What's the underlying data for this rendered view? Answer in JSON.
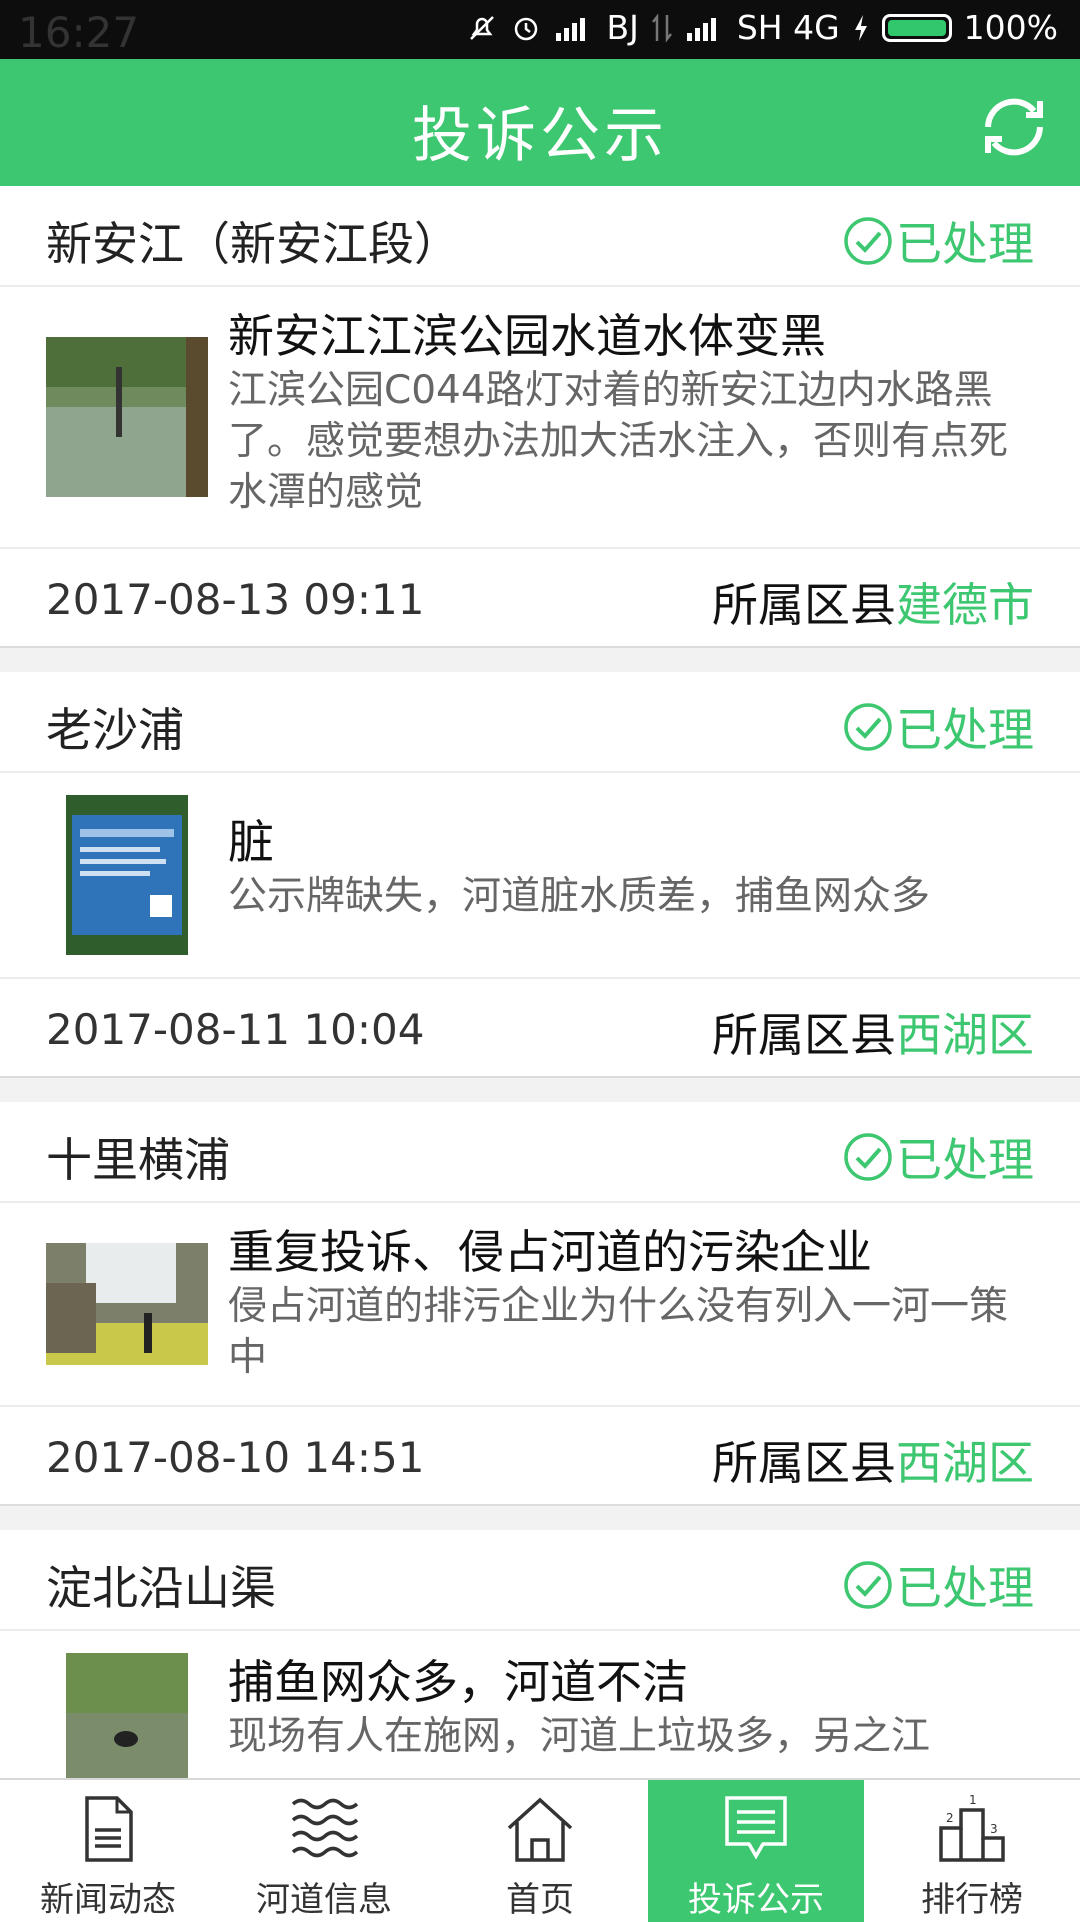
{
  "status_bar": {
    "time": "16:27",
    "carrier1": "BJ",
    "carrier2": "SH 4G",
    "battery": "100%"
  },
  "appbar": {
    "title": "投诉公示",
    "refresh_icon": "refresh-icon"
  },
  "complaints": [
    {
      "river": "新安江（新安江段）",
      "status": "已处理",
      "subject": "新安江江滨公园水道水体变黑",
      "description": "江滨公园C044路灯对着的新安江边内水路黑了。感觉要想办法加大活水注入，否则有点死水潭的感觉",
      "time": "2017-08-13 09:11",
      "district_label": "所属区县",
      "district": "建德市"
    },
    {
      "river": "老沙浦",
      "status": "已处理",
      "subject": "脏",
      "description": "公示牌缺失，河道脏水质差，捕鱼网众多",
      "time": "2017-08-11 10:04",
      "district_label": "所属区县",
      "district": "西湖区"
    },
    {
      "river": "十里横浦",
      "status": "已处理",
      "subject": "重复投诉、侵占河道的污染企业",
      "description": "侵占河道的排污企业为什么没有列入一河一策中",
      "time": "2017-08-10 14:51",
      "district_label": "所属区县",
      "district": "西湖区"
    },
    {
      "river": "淀北沿山渠",
      "status": "已处理",
      "subject": "捕鱼网众多，河道不洁",
      "description": "现场有人在施网，河道上垃圾多，另之江",
      "time": "",
      "district_label": "",
      "district": ""
    }
  ],
  "tabs": [
    {
      "label": "新闻动态",
      "icon": "document-icon",
      "active": false
    },
    {
      "label": "河道信息",
      "icon": "waves-icon",
      "active": false
    },
    {
      "label": "首页",
      "icon": "home-icon",
      "active": false
    },
    {
      "label": "投诉公示",
      "icon": "message-icon",
      "active": true
    },
    {
      "label": "排行榜",
      "icon": "podium-icon",
      "active": false
    }
  ],
  "colors": {
    "accent": "#3dc770",
    "status_bar": "#0d0d0d"
  }
}
